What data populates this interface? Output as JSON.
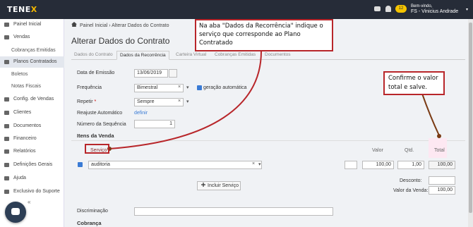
{
  "brand": {
    "letters": "TENE",
    "accent_letter": "X"
  },
  "header": {
    "notif_count": "12",
    "greeting": "Bem-vindo,",
    "user": "FS - Vinicius Andrade"
  },
  "sidebar": {
    "items": [
      {
        "label": "Painel Inicial",
        "icon": "home-icon",
        "active": false
      },
      {
        "label": "Vendas",
        "icon": "cart-icon",
        "active": false
      },
      {
        "label": "Cobranças Emitidas",
        "sub": true,
        "active": false
      },
      {
        "label": "Planos Contratados",
        "icon": "document-icon",
        "active": true
      },
      {
        "label": "Boletos",
        "sub": true,
        "active": false
      },
      {
        "label": "Notas Fiscais",
        "sub": true,
        "active": false
      },
      {
        "label": "Config. de Vendas",
        "icon": "gear-icon",
        "active": false
      },
      {
        "label": "Clientes",
        "icon": "user-icon",
        "active": false
      },
      {
        "label": "Documentos",
        "icon": "file-icon",
        "active": false
      },
      {
        "label": "Financeiro",
        "icon": "money-icon",
        "active": false
      },
      {
        "label": "Relatórios",
        "icon": "chart-icon",
        "active": false
      },
      {
        "label": "Definições Gerais",
        "icon": "settings-icon",
        "active": false
      },
      {
        "label": "Ajuda",
        "icon": "help-icon",
        "active": false
      },
      {
        "label": "Exclusivo do Suporte",
        "icon": "link-icon",
        "active": false
      }
    ]
  },
  "breadcrumb": {
    "home": "Painel Inicial",
    "sep": "›",
    "current": "Alterar Dados do Contrato"
  },
  "page": {
    "title": "Alterar Dados do Contrato"
  },
  "tabs": [
    "Dados do Contrato",
    "Dados da Recorrência",
    "Carteira Virtual",
    "Cobranças Emitidas",
    "Documentos"
  ],
  "form": {
    "emissao_label": "Data de Emissão",
    "emissao_value": "13/06/2019",
    "frequencia_label": "Frequência",
    "frequencia_value": "Bimestral",
    "geracao_label": "geração automática",
    "repetir_label": "Repetir",
    "repetir_req": "*",
    "repetir_value": "Sempre",
    "reajuste_label": "Reajuste Automático",
    "reajuste_link": "definir",
    "sequencia_label": "Número da Sequência",
    "sequencia_value": "1"
  },
  "itens": {
    "title": "Itens da Venda",
    "col_servico": "Serviço",
    "col_valor": "Valor",
    "col_qtd": "Qtd.",
    "col_total": "Total",
    "servico_value": "auditoria",
    "valor_value": "100,00",
    "qtd_value": "1,00",
    "total_value": "100,00",
    "add_button": "Incluir Serviço",
    "desconto_label": "Desconto:",
    "valor_venda_label": "Valor da Venda:",
    "valor_venda_value": "100,00"
  },
  "discriminacao_label": "Discriminação",
  "cobranca_title": "Cobrança",
  "x_mark": "×",
  "caret": "▾",
  "check_mark": "✓",
  "chevron_left": "«",
  "annotations": {
    "tab_note": "Na aba \"Dados da Recorrência\" indique o serviço que corresponde ao Plano Contratado",
    "total_note": "Confirme o valor total e salve."
  },
  "colors": {
    "topbar": "#262c38",
    "accent": "#f5b800",
    "annotation": "#b8262a",
    "link": "#3a7bd5"
  }
}
